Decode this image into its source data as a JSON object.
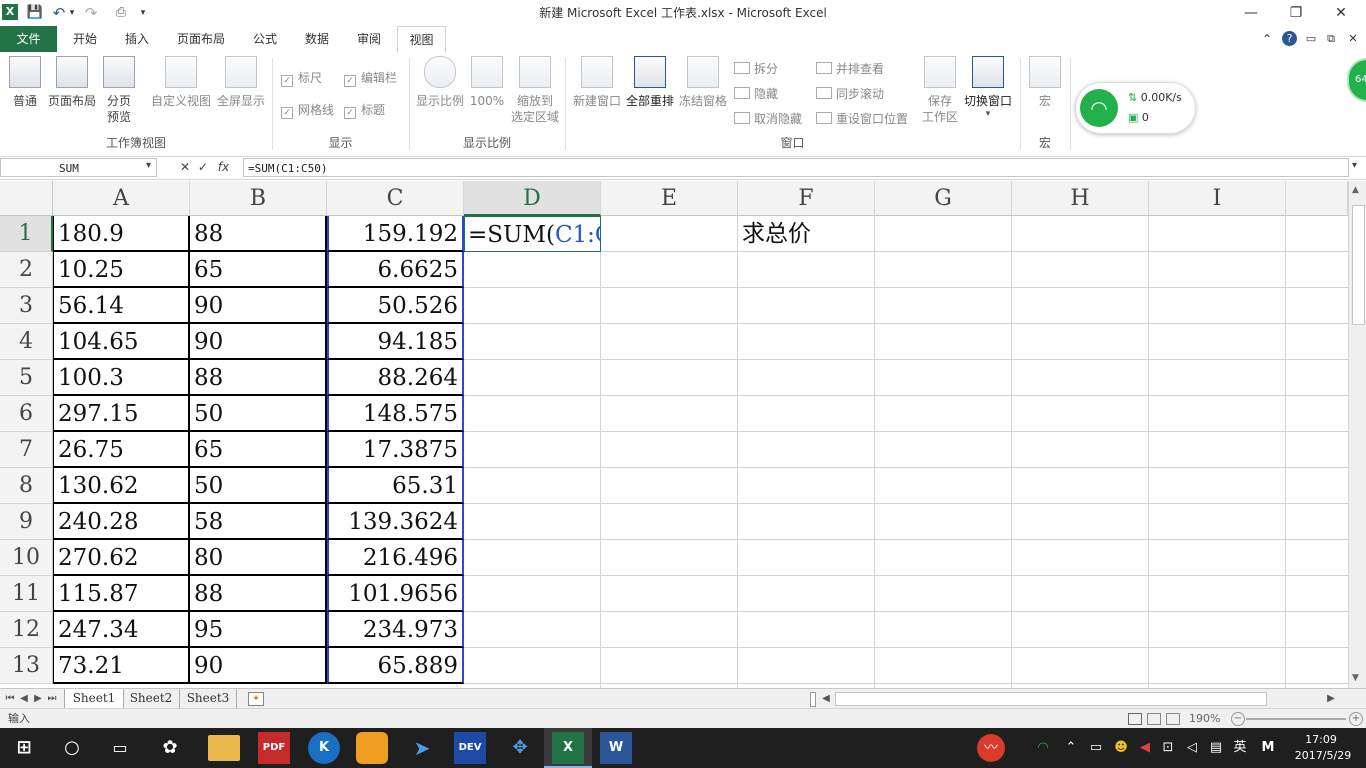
{
  "window": {
    "title": "新建 Microsoft Excel 工作表.xlsx - Microsoft Excel",
    "minimize": "—",
    "restore": "❐",
    "close": "✕"
  },
  "qat": {
    "app_icon": "X",
    "save": "💾",
    "undo": "↶",
    "redo": "↷",
    "print": "⎙",
    "more": "▾"
  },
  "tabs": [
    "文件",
    "开始",
    "插入",
    "页面布局",
    "公式",
    "数据",
    "审阅",
    "视图"
  ],
  "ribbon_right": {
    "up": "⌃",
    "help": "?",
    "min": "▭",
    "restore": "⧉",
    "close": "✕"
  },
  "ribbon": {
    "workbook_views": {
      "label": "工作簿视图",
      "normal": "普通",
      "page_layout": "页面布局",
      "page_break_1": "分页",
      "page_break_2": "预览",
      "custom_views": "自定义视图",
      "full_screen": "全屏显示"
    },
    "show": {
      "label": "显示",
      "ruler": "标尺",
      "formula_bar": "编辑栏",
      "gridlines": "网格线",
      "headings": "标题"
    },
    "zoom": {
      "label": "显示比例",
      "zoom": "显示比例",
      "zoom100": "100%",
      "zoom_sel_1": "缩放到",
      "zoom_sel_2": "选定区域"
    },
    "window": {
      "label": "窗口",
      "new_window": "新建窗口",
      "arrange_all": "全部重排",
      "freeze": "冻结窗格",
      "split": "拆分",
      "hide": "隐藏",
      "unhide": "取消隐藏",
      "side_by_side": "并排查看",
      "sync_scroll": "同步滚动",
      "reset_position": "重设窗口位置",
      "save_ws_1": "保存",
      "save_ws_2": "工作区",
      "switch": "切换窗口"
    },
    "macros": {
      "label": "宏",
      "macros": "宏"
    }
  },
  "wifi_widget": {
    "speed": "0.00K/s",
    "count": "0",
    "badge": "64"
  },
  "formula_bar": {
    "name_box": "SUM",
    "cancel": "✕",
    "enter": "✓",
    "fx": "fx",
    "formula": "=SUM(C1:C50)"
  },
  "columns": [
    "A",
    "B",
    "C",
    "D",
    "E",
    "F",
    "G",
    "H",
    "I"
  ],
  "rows": [
    {
      "n": "1",
      "a": "180.9",
      "b": "88",
      "c": "159.192"
    },
    {
      "n": "2",
      "a": "10.25",
      "b": "65",
      "c": "6.6625"
    },
    {
      "n": "3",
      "a": "56.14",
      "b": "90",
      "c": "50.526"
    },
    {
      "n": "4",
      "a": "104.65",
      "b": "90",
      "c": "94.185"
    },
    {
      "n": "5",
      "a": "100.3",
      "b": "88",
      "c": "88.264"
    },
    {
      "n": "6",
      "a": "297.15",
      "b": "50",
      "c": "148.575"
    },
    {
      "n": "7",
      "a": "26.75",
      "b": "65",
      "c": "17.3875"
    },
    {
      "n": "8",
      "a": "130.62",
      "b": "50",
      "c": "65.31"
    },
    {
      "n": "9",
      "a": "240.28",
      "b": "58",
      "c": "139.3624"
    },
    {
      "n": "10",
      "a": "270.62",
      "b": "80",
      "c": "216.496"
    },
    {
      "n": "11",
      "a": "115.87",
      "b": "88",
      "c": "101.9656"
    },
    {
      "n": "12",
      "a": "247.34",
      "b": "95",
      "c": "234.973"
    },
    {
      "n": "13",
      "a": "73.21",
      "b": "90",
      "c": "65.889"
    }
  ],
  "editing_cell": {
    "prefix": "=SUM(",
    "ref": "C1:C50",
    "suffix": ")"
  },
  "f1_text": "求总价",
  "sheets": [
    "Sheet1",
    "Sheet2",
    "Sheet3"
  ],
  "status": {
    "mode": "输入",
    "zoom": "190%"
  },
  "taskbar": {
    "apps": [
      "PDF",
      "K",
      "DEV",
      "X",
      "W"
    ],
    "tray": {
      "lang": "英",
      "ime": "M"
    },
    "time": "17:09",
    "date": "2017/5/29"
  }
}
